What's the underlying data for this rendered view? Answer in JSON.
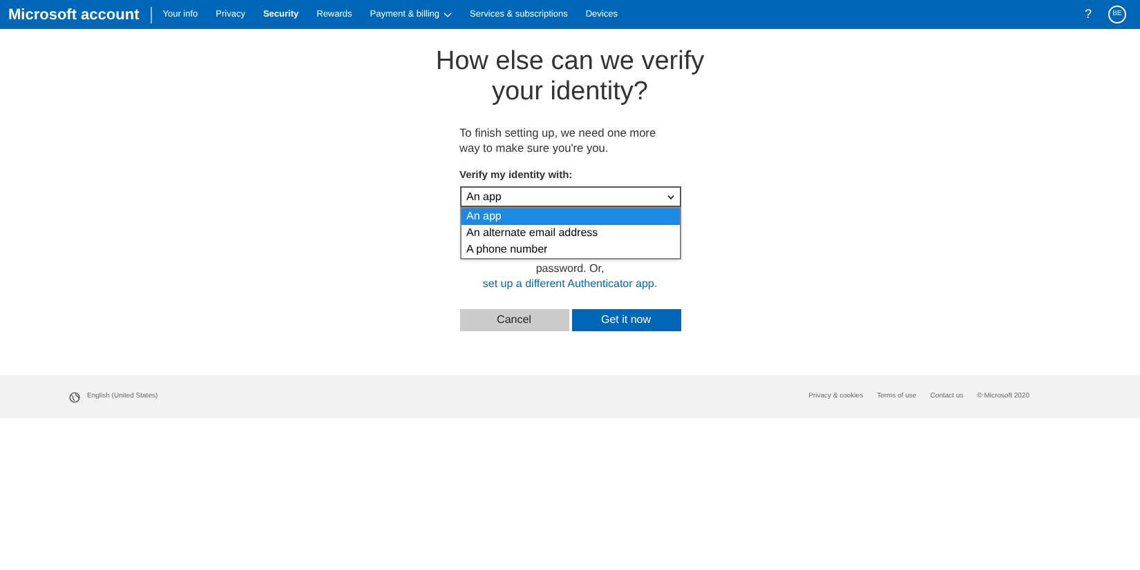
{
  "header": {
    "brand": "Microsoft account",
    "nav": [
      {
        "label": "Your info",
        "selected": false
      },
      {
        "label": "Privacy",
        "selected": false
      },
      {
        "label": "Security",
        "selected": true
      },
      {
        "label": "Rewards",
        "selected": false
      },
      {
        "label": "Payment & billing",
        "selected": false,
        "dropdown": true
      },
      {
        "label": "Services & subscriptions",
        "selected": false
      },
      {
        "label": "Devices",
        "selected": false
      }
    ],
    "help": "?",
    "avatar": "BE"
  },
  "title": "How else can we verify your identity?",
  "intro": "To finish setting up, we need one more way to make sure you're you.",
  "field_label": "Verify my identity with:",
  "select": {
    "value": "An app",
    "options": [
      {
        "label": "An app",
        "selected": true
      },
      {
        "label": "An alternate email address",
        "selected": false
      },
      {
        "label": "A phone number",
        "selected": false
      }
    ]
  },
  "note": "password. Or,",
  "note_link": "set up a different Authenticator app.",
  "buttons": [
    {
      "label": "Cancel",
      "kind": "secondary"
    },
    {
      "label": "Get it now",
      "kind": "primary"
    }
  ],
  "footer": {
    "language": "English (United States)",
    "links": [
      "Privacy & cookies",
      "Terms of use",
      "Contact us",
      "© Microsoft 2020"
    ]
  }
}
